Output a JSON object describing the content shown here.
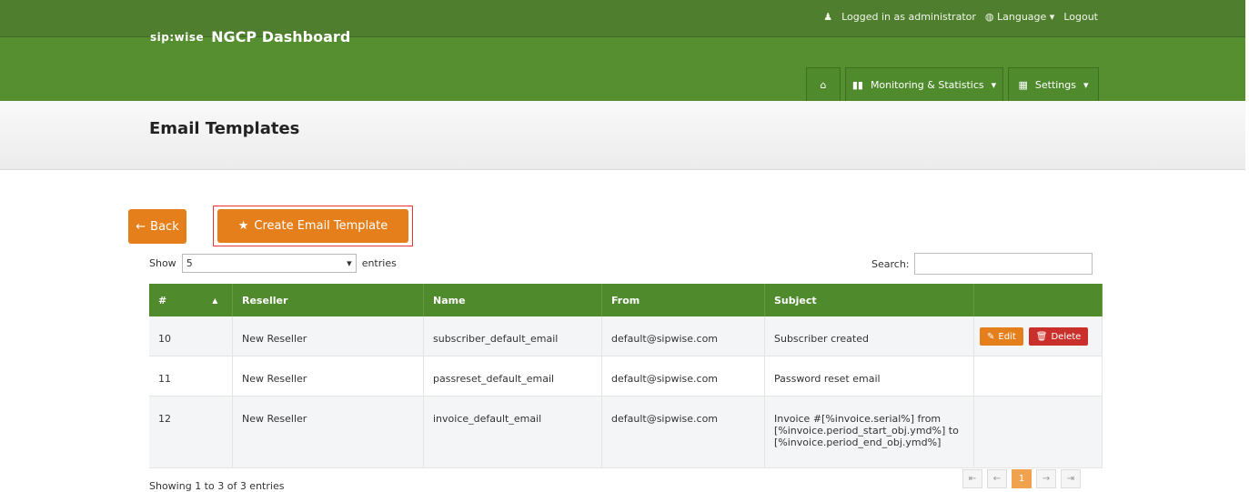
{
  "topbar": {
    "logged_in": "Logged in as administrator",
    "language": "Language",
    "logout": "Logout"
  },
  "header": {
    "brand_logo": "sip:wise",
    "brand": "NGCP Dashboard",
    "nav": {
      "home_icon": "home-icon",
      "monitoring": "Monitoring & Statistics",
      "settings": "Settings"
    }
  },
  "page": {
    "title": "Email Templates",
    "back": "Back",
    "create": "Create Email Template",
    "show": "Show",
    "show_value": "5",
    "entries": "entries",
    "search_label": "Search:",
    "table_headers": [
      "#",
      "Reseller",
      "Name",
      "From",
      "Subject",
      ""
    ],
    "rows": [
      [
        "10",
        "New Reseller",
        "subscriber_default_email",
        "default@sipwise.com",
        "Subscriber created"
      ],
      [
        "11",
        "New Reseller",
        "passreset_default_email",
        "default@sipwise.com",
        "Password reset email"
      ],
      [
        "12",
        "New Reseller",
        "invoice_default_email",
        "default@sipwise.com",
        "Invoice #[%invoice.serial%] from [%invoice.period_start_obj.ymd%] to [%invoice.period_end_obj.ymd%]"
      ]
    ],
    "edit": "Edit",
    "delete": "Delete",
    "footer": "Showing 1 to 3 of 3 entries",
    "pager": [
      "⇤",
      "←",
      "1",
      "→",
      "⇥"
    ]
  },
  "colors": {
    "green": "#558f2f",
    "orange": "#e47f1c",
    "red": "#c9302c"
  }
}
